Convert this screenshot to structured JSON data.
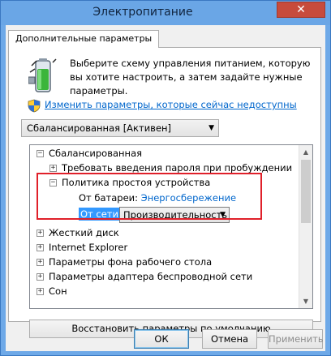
{
  "window": {
    "title": "Электропитание",
    "close_glyph": "✕"
  },
  "tab": {
    "label": "Дополнительные параметры"
  },
  "intro": {
    "text": "Выберите схему управления питанием, которую вы хотите настроить, а затем задайте нужные параметры."
  },
  "change_link": {
    "label": "Изменить параметры, которые сейчас недоступны"
  },
  "scheme_select": {
    "value": "Сбалансированная [Активен]"
  },
  "tree": {
    "root": "Сбалансированная",
    "password": "Требовать введения пароля при пробуждении",
    "idle_policy": "Политика простоя устройства",
    "on_battery_label": "От батареи:",
    "on_battery_value": "Энергосбережение",
    "plugged_in_label": "От сети:",
    "plugged_in_value": "Производительность",
    "items": [
      "Жесткий диск",
      "Internet Explorer",
      "Параметры фона рабочего стола",
      "Параметры адаптера беспроводной сети",
      "Сон"
    ]
  },
  "restore_button": {
    "label": "Восстановить параметры по умолчанию"
  },
  "buttons": {
    "ok": "ОК",
    "cancel": "Отмена",
    "apply": "Применить"
  },
  "colors": {
    "title_bar": "#6aa6e6",
    "close": "#c74b3c",
    "link": "#0066cc",
    "selection": "#3399ff",
    "highlight": "#e0202a"
  }
}
